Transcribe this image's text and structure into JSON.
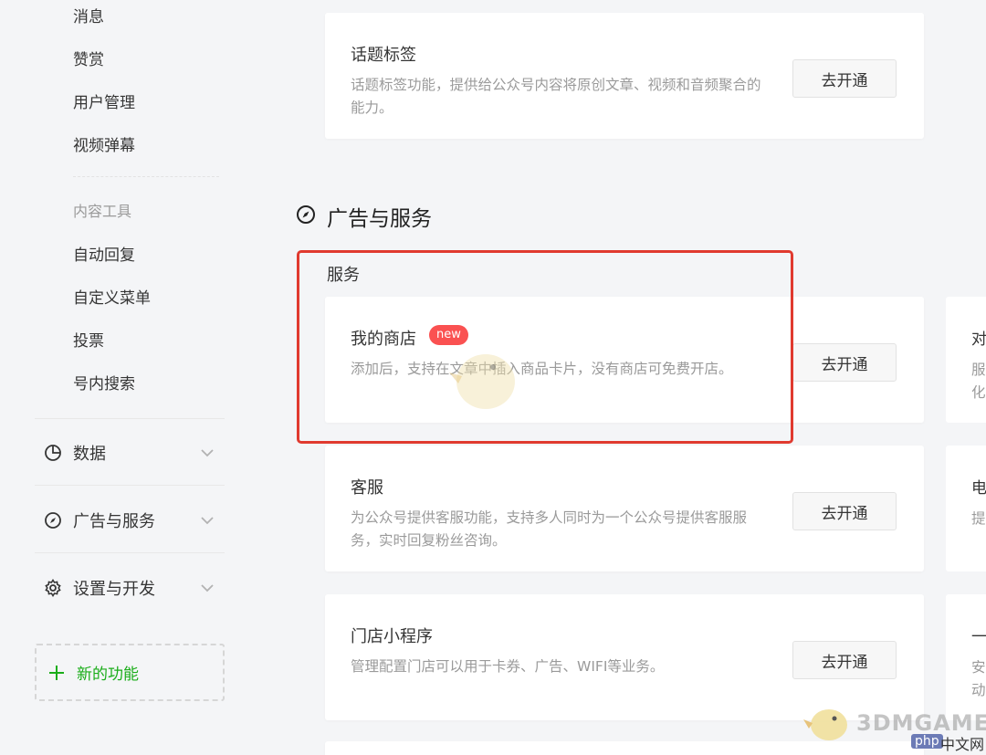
{
  "sidebar": {
    "items_top": [
      "消息",
      "赞赏",
      "用户管理",
      "视频弹幕"
    ],
    "group_title": "内容工具",
    "items_tools": [
      "自动回复",
      "自定义菜单",
      "投票",
      "号内搜索"
    ],
    "sections": [
      {
        "label": "数据",
        "icon": "pie-chart-icon"
      },
      {
        "label": "广告与服务",
        "icon": "compass-icon"
      },
      {
        "label": "设置与开发",
        "icon": "gear-icon"
      }
    ],
    "new_function": "新的功能"
  },
  "main": {
    "topic_card": {
      "title": "话题标签",
      "desc": "话题标签功能，提供给公众号内容将原创文章、视频和音频聚合的能力。",
      "button": "去开通"
    },
    "section_title": "广告与服务",
    "sub_title": "服务",
    "cards": [
      {
        "title": "我的商店",
        "badge": "new",
        "desc": "添加后，支持在文章中插入商品卡片，没有商店可免费开店。",
        "button": "去开通"
      },
      {
        "title": "客服",
        "desc": "为公众号提供客服功能，支持多人同时为一个公众号提供客服服务，实时回复粉丝咨询。",
        "button": "去开通"
      },
      {
        "title": "门店小程序",
        "desc": "管理配置门店可以用于卡券、广告、WIFI等业务。",
        "button": "去开通"
      }
    ],
    "right_cards": [
      {
        "title": "对",
        "lines": [
          "服",
          "化"
        ]
      },
      {
        "title": "电",
        "lines": [
          "提"
        ]
      },
      {
        "title": "一",
        "lines": [
          "安",
          "动"
        ]
      }
    ]
  },
  "colors": {
    "accent_green": "#1aad19",
    "highlight_red": "#e03a2f",
    "badge_red": "#fa5151"
  },
  "watermark": {
    "brand": "3DMGAME",
    "php": "php",
    "zw": "中文网"
  }
}
